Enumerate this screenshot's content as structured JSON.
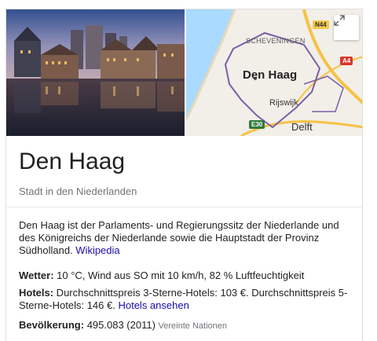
{
  "images": {
    "map": {
      "labels": {
        "scheveningen": "SCHEVENINGEN",
        "city": "Den Haag",
        "rijswijk": "Rijswijk",
        "delft": "Delft"
      },
      "shields": {
        "n44": "N44",
        "a4": "A4",
        "e30": "E30"
      },
      "colors": {
        "sea": "#aadaff",
        "land": "#f2efe9",
        "boundary": "#7b5ea7",
        "highway": "#f6c243"
      }
    },
    "expand_icon": "expand-icon"
  },
  "header": {
    "title": "Den Haag",
    "subtitle": "Stadt in den Niederlanden"
  },
  "description": {
    "text": "Den Haag ist der Parlaments- und Regierungssitz der Niederlande und des Königreichs der Niederlande sowie die Hauptstadt der Provinz Südholland. ",
    "source_link": "Wikipedia"
  },
  "facts": {
    "weather": {
      "label": "Wetter:",
      "value": " 10 °C, Wind aus SO mit 10 km/h, 82 % Luftfeuchtigkeit"
    },
    "hotels": {
      "label": "Hotels:",
      "value": " Durchschnittspreis 3-Sterne-Hotels: 103 €. Durchschnittspreis 5-Sterne-Hotels: 146 €. ",
      "link": "Hotels ansehen"
    },
    "population": {
      "label": "Bevölkerung:",
      "value": " 495.083 (2011) ",
      "source": "Vereinte Nationen"
    }
  },
  "colors": {
    "link": "#1a0dab",
    "muted": "#70757a",
    "text": "#222222"
  }
}
